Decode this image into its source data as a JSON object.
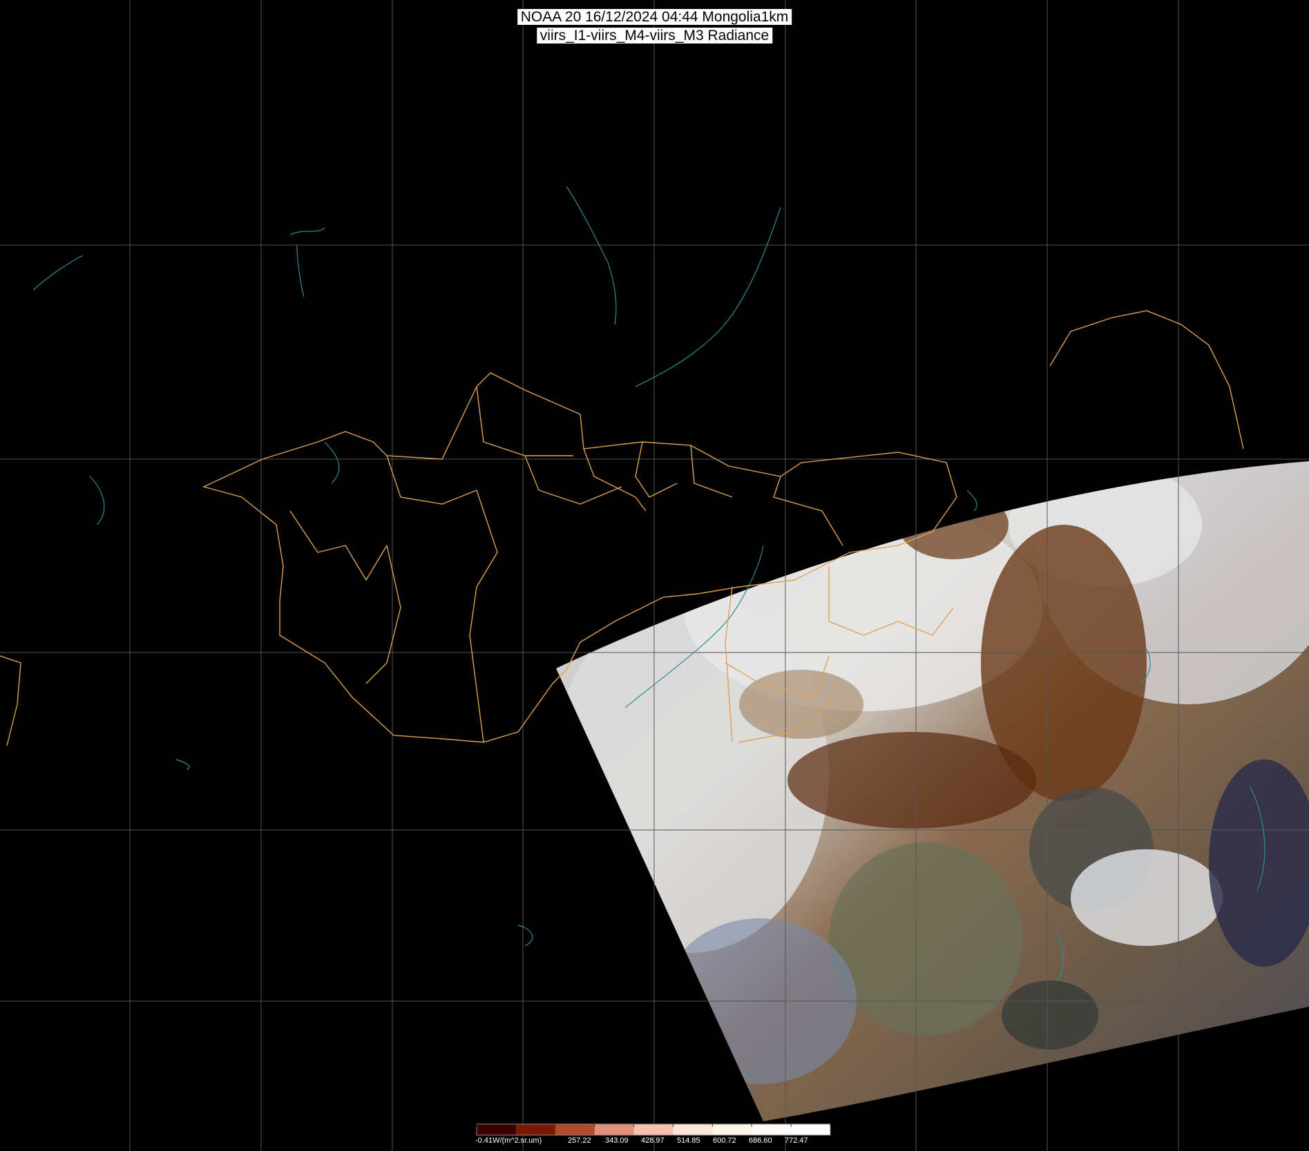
{
  "header": {
    "line1": "NOAA 20 16/12/2024 04:44 Mongolia1km",
    "line2": "viirs_I1-viirs_M4-viirs_M3 Radiance"
  },
  "legend": {
    "labels": [
      "-0.41W/(m^2.sr.um)",
      "257.22",
      "343.09",
      "428.97",
      "514.85",
      "600.72",
      "686.60",
      "772.47"
    ],
    "colors": [
      "#3a0000",
      "#7a1a06",
      "#b04a2a",
      "#e0907a",
      "#f4c2ae",
      "#fbe6d8",
      "#fff4e8",
      "#fffaf4",
      "#ffffff"
    ]
  },
  "colors": {
    "background": "#000000",
    "grid": "#555555",
    "borders": "#e0a050",
    "water": "#2a8a9a"
  }
}
